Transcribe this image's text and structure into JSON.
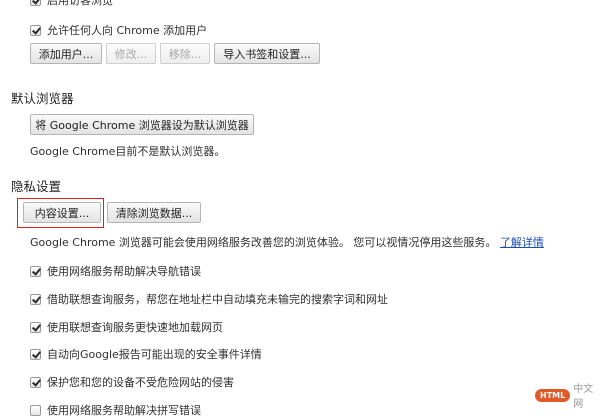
{
  "top_partial": {
    "checkbox_label": "启用访客浏览",
    "checked": true
  },
  "users": {
    "allow_add_label": "允许任何人向 Chrome 添加用户",
    "allow_add_checked": true,
    "buttons": [
      {
        "label": "添加用户...",
        "disabled": false
      },
      {
        "label": "修改...",
        "disabled": true
      },
      {
        "label": "移除...",
        "disabled": true
      },
      {
        "label": "导入书签和设置...",
        "disabled": false
      }
    ]
  },
  "default_browser": {
    "title": "默认浏览器",
    "button_label": "将 Google Chrome 浏览器设为默认浏览器",
    "status": "Google Chrome目前不是默认浏览器。"
  },
  "privacy": {
    "title": "隐私设置",
    "content_settings_label": "内容设置...",
    "clear_data_label": "清除浏览数据...",
    "description": "Google Chrome 浏览器可能会使用网络服务改善您的浏览体验。 您可以视情况停用这些服务。",
    "learn_more_label": "了解详情",
    "options": [
      {
        "label": "使用网络服务帮助解决导航错误",
        "checked": true
      },
      {
        "label": "借助联想查询服务，帮您在地址栏中自动填充未输完的搜索字词和网址",
        "checked": true
      },
      {
        "label": "使用联想查询服务更快速地加载网页",
        "checked": true
      },
      {
        "label": "自动向Google报告可能出现的安全事件详情",
        "checked": true
      },
      {
        "label": "保护您和您的设备不受危险网站的侵害",
        "checked": true
      },
      {
        "label": "使用网络服务帮助解决拼写错误",
        "checked": false
      }
    ]
  },
  "highlight_color": "#e11d1d",
  "watermark": {
    "badge": "HTML",
    "text": "中文网"
  }
}
